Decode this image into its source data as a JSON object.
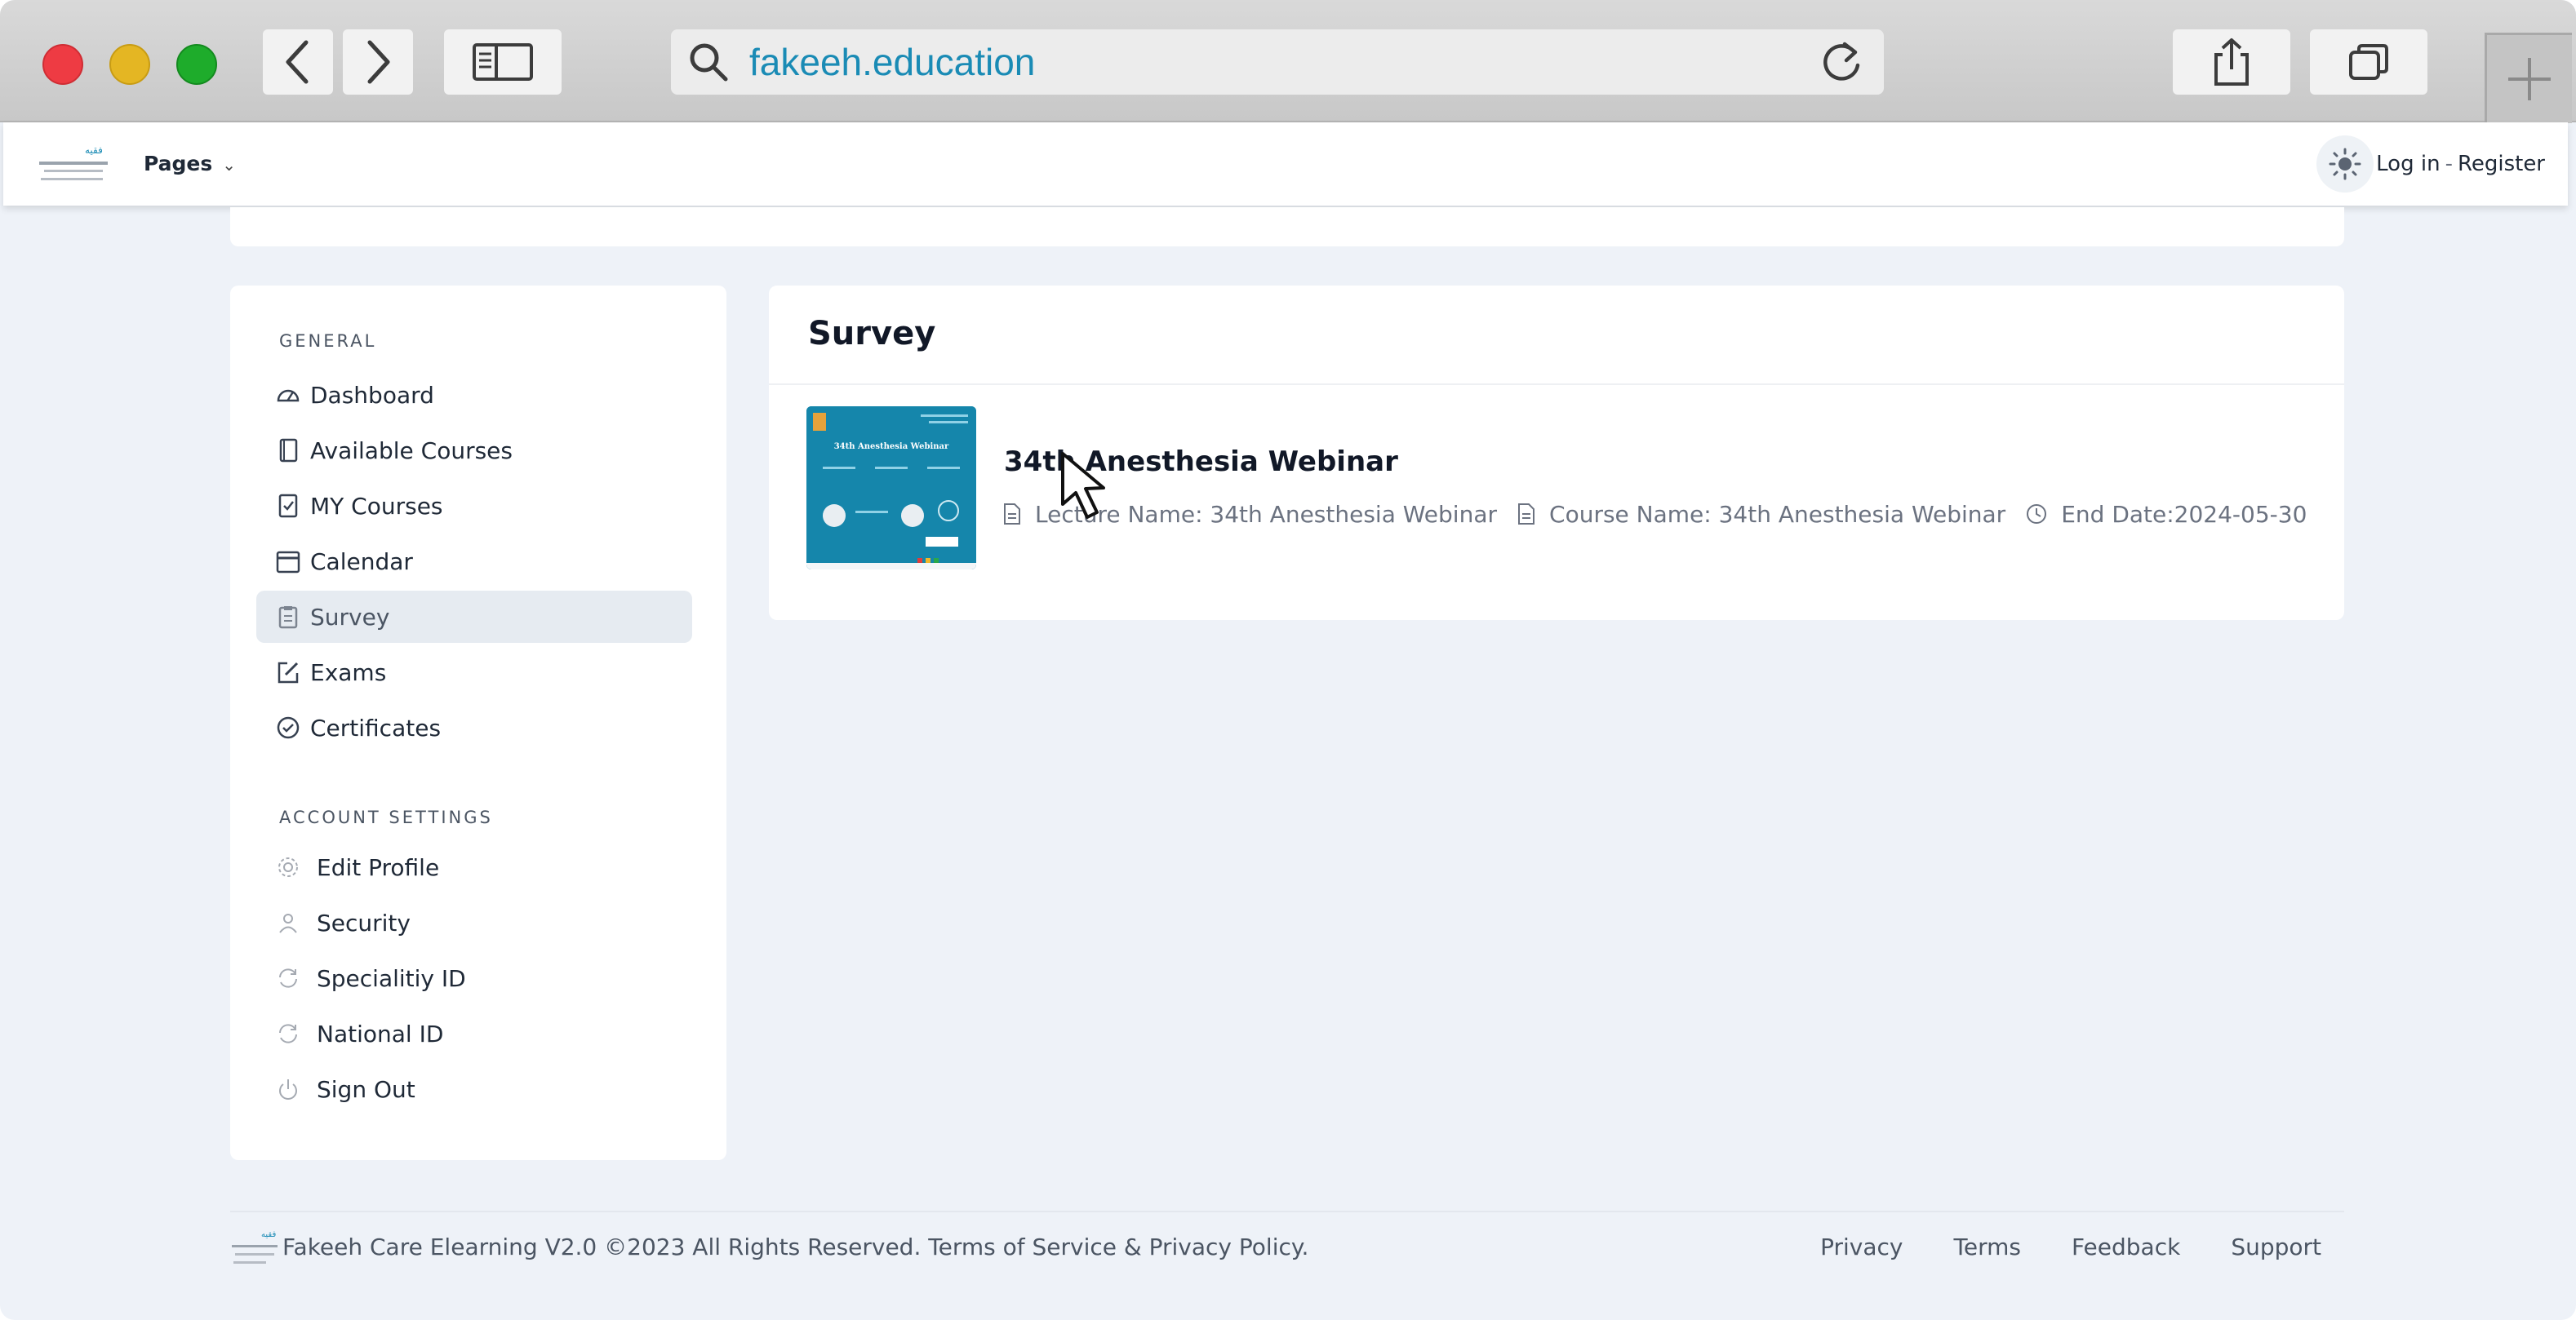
{
  "browser": {
    "url": "fakeeh.education"
  },
  "navbar": {
    "pages_label": "Pages",
    "login_label": "Log in",
    "separator": "-",
    "register_label": "Register"
  },
  "sidebar": {
    "general_heading": "GENERAL",
    "general_items": [
      {
        "label": "Dashboard",
        "icon": "dashboard-icon"
      },
      {
        "label": "Available Courses",
        "icon": "book-icon"
      },
      {
        "label": "MY Courses",
        "icon": "checklist-icon"
      },
      {
        "label": "Calendar",
        "icon": "calendar-icon"
      },
      {
        "label": "Survey",
        "icon": "clipboard-icon",
        "active": true
      },
      {
        "label": "Exams",
        "icon": "edit-icon"
      },
      {
        "label": "Certificates",
        "icon": "check-circle-icon"
      }
    ],
    "account_heading": "ACCOUNT SETTINGS",
    "account_items": [
      {
        "label": "Edit Profile",
        "icon": "gear-icon"
      },
      {
        "label": "Security",
        "icon": "user-icon"
      },
      {
        "label": "Specialitiy ID",
        "icon": "refresh-icon"
      },
      {
        "label": "National ID",
        "icon": "refresh-icon"
      },
      {
        "label": "Sign Out",
        "icon": "power-icon"
      }
    ]
  },
  "survey": {
    "title": "Survey",
    "items": [
      {
        "title": "34th Anesthesia Webinar",
        "lecture": "Lecture Name: 34th Anesthesia Webinar",
        "course": "Course Name: 34th Anesthesia Webinar",
        "end_date": "End Date:2024-05-30",
        "thumbnail_text": "34th Anesthesia Webinar"
      }
    ]
  },
  "footer": {
    "copyright": "Fakeeh Care Elearning V2.0 ©2023 All Rights Reserved. Terms of Service & Privacy Policy.",
    "links": [
      "Privacy",
      "Terms",
      "Feedback",
      "Support"
    ]
  },
  "colors": {
    "accent_url": "#1a8bb5",
    "page_bg": "#eef2f8",
    "active_bg": "#e6ebf1",
    "thumbnail_bg": "#1584a8"
  }
}
